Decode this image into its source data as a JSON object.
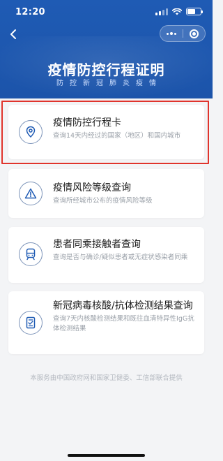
{
  "status_bar": {
    "time": "12:20"
  },
  "header": {
    "title": "疫情防控行程证明",
    "subtitle": "防控新冠肺炎疫情"
  },
  "cards": [
    {
      "title": "疫情防控行程卡",
      "desc": "查询14天内经过的国家（地区）和国内城市",
      "icon": "location-pin-icon"
    },
    {
      "title": "疫情风险等级查询",
      "desc": "查询所经城市公布的疫情风险等级",
      "icon": "warning-icon"
    },
    {
      "title": "患者同乘接触者查询",
      "desc": "查询是否与确诊/疑似患者或无症状感染者同乘",
      "icon": "train-icon"
    },
    {
      "title": "新冠病毒核酸/抗体检测结果查询",
      "desc": "查询7天内核酸检测结果和既往血清特异性IgG抗体检测结果",
      "icon": "test-report-icon"
    }
  ],
  "footer": {
    "text": "本服务由中国政府网和国家卫健委、工信部联合提供"
  },
  "colors": {
    "header_bg": "#1f5bb4",
    "icon_stroke": "#7b93b8",
    "highlight": "#e0342c",
    "page_bg": "#f3f4f6"
  }
}
